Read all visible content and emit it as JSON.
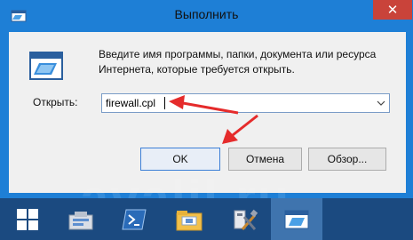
{
  "window": {
    "title": "Выполнить",
    "close_glyph": "✕"
  },
  "dialog": {
    "description": "Введите имя программы, папки, документа или ресурса Интернета, которые требуется открыть.",
    "open_label": "Открыть:",
    "open_value": "firewall.cpl"
  },
  "buttons": {
    "ok": "OK",
    "cancel": "Отмена",
    "browse": "Обзор..."
  },
  "watermark": "avalil.ru",
  "taskbar": {
    "items": [
      "start-windows-icon",
      "server-manager-icon",
      "powershell-icon",
      "file-explorer-icon",
      "admin-tools-icon",
      "run-icon"
    ]
  },
  "colors": {
    "window_frame": "#1e7fd6",
    "close_button": "#c9433a",
    "arrow": "#e52b2b",
    "taskbar": "#1b4a80"
  }
}
